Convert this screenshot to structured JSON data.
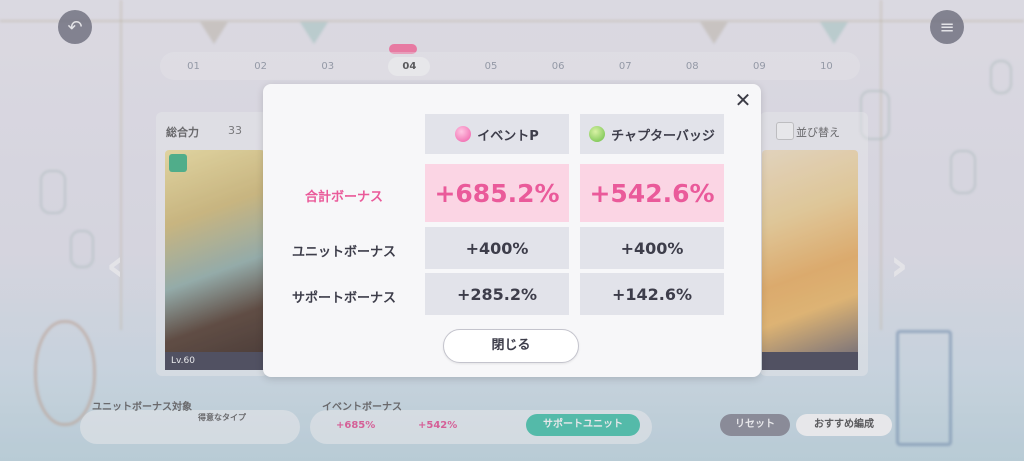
{
  "background": {
    "page_numbers": [
      "01",
      "02",
      "03",
      "04",
      "05",
      "06",
      "07",
      "08",
      "09",
      "10"
    ],
    "active_page": "04",
    "left_panel_label": "総合力",
    "left_panel_value": "33",
    "left_card_level": "Lv.60",
    "right_panel_label": "並び替え",
    "unit_bonus_label": "ユニットボーナス対象",
    "type_label": "得意なタイプ",
    "event_bonus_label": "イベントボーナス",
    "event_bonus_p": "+685%",
    "event_bonus_badge": "+542%",
    "support_unit_button": "サポートユニット",
    "reset_button": "リセット",
    "recommend_button": "おすすめ編成"
  },
  "dialog": {
    "close_icon": "close-icon",
    "columns": [
      {
        "label": "イベントP",
        "icon": "event-point-icon",
        "color": "#ee5ca7"
      },
      {
        "label": "チャプターバッジ",
        "icon": "chapter-badge-icon",
        "color": "#69bd45"
      }
    ],
    "rows": [
      {
        "label": "合計ボーナス",
        "values": [
          "+685.2%",
          "+542.6%"
        ]
      },
      {
        "label": "ユニットボーナス",
        "values": [
          "+400%",
          "+400%"
        ]
      },
      {
        "label": "サポートボーナス",
        "values": [
          "+285.2%",
          "+142.6%"
        ]
      }
    ],
    "close_button": "閉じる",
    "accent_color": "#ea5a9a"
  }
}
